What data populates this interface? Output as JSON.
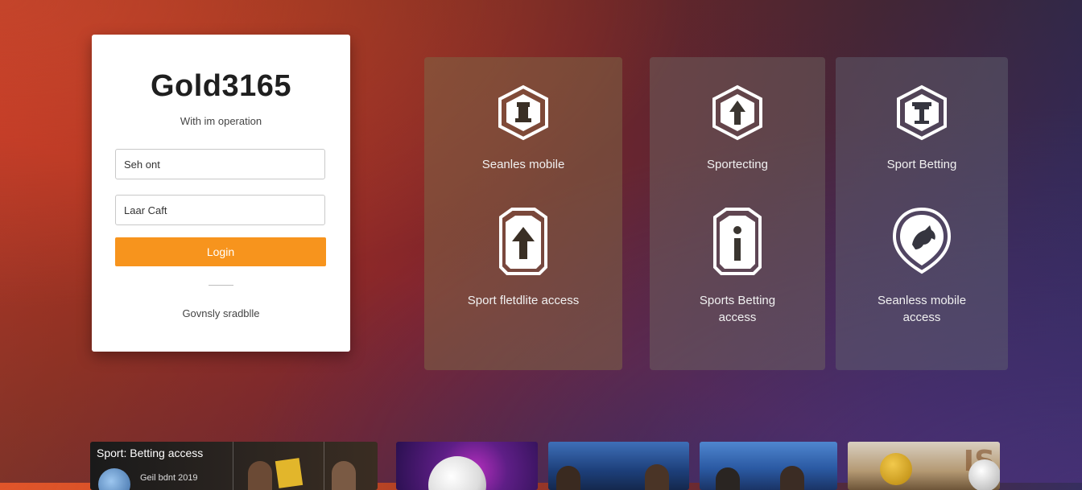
{
  "login": {
    "brand": "Gold3165",
    "subtitle": "With im operation",
    "username_placeholder": "Seh ont",
    "password_placeholder": "Laar Caft",
    "login_label": "Login",
    "footer_link": "Govnsly sradblle"
  },
  "features": [
    {
      "top": {
        "icon": "chess-tower-icon",
        "label": "Seanles mobile"
      },
      "bottom": {
        "icon": "arrow-up-shield-icon",
        "label": "Sport fletdlite access"
      }
    },
    {
      "top": {
        "icon": "arrow-up-icon",
        "label": "Sportecting"
      },
      "bottom": {
        "icon": "info-shield-icon",
        "label": "Sports Betting access"
      }
    },
    {
      "top": {
        "icon": "trophy-icon",
        "label": "Sport Betting"
      },
      "bottom": {
        "icon": "horse-shield-icon",
        "label": "Seanless mobile access"
      }
    }
  ],
  "thumbnails": {
    "first": {
      "caption": "Sport: Betting access",
      "sub": "Geil bdnt 2019"
    },
    "fifth_text": "IS"
  },
  "colors": {
    "accent": "#f7941d",
    "card": "#ffffff"
  }
}
